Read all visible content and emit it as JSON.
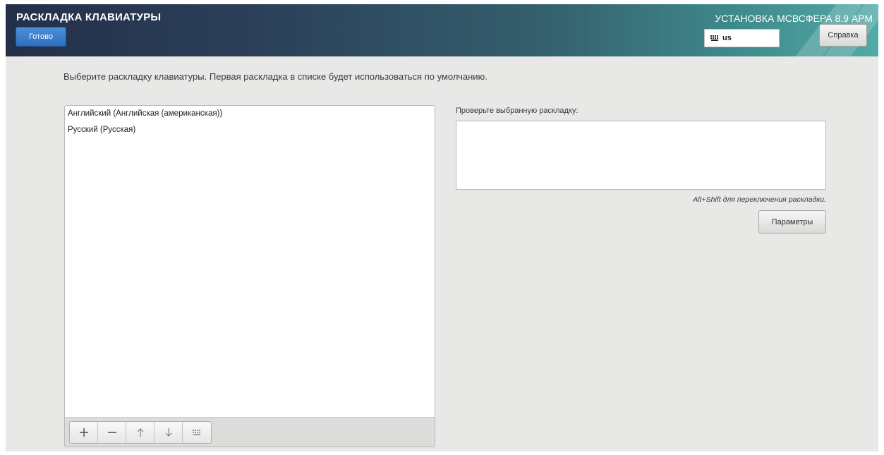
{
  "header": {
    "title": "РАСКЛАДКА КЛАВИАТУРЫ",
    "done_label": "Готово",
    "product_title": "УСТАНОВКА МСВСФЕРА 8.9 АРМ",
    "keyboard_indicator": "us",
    "help_label": "Справка"
  },
  "instruction": "Выберите раскладку клавиатуры. Первая раскладка в списке будет использоваться по умолчанию.",
  "layouts": [
    "Английский (Английская (американская))",
    "Русский (Русская)"
  ],
  "toolbar": {
    "add_icon": "plus-icon",
    "remove_icon": "minus-icon",
    "up_icon": "arrow-up-icon",
    "down_icon": "arrow-down-icon",
    "preview_icon": "keyboard-icon"
  },
  "test_panel": {
    "label": "Проверьте выбранную раскладку:",
    "value": "",
    "switch_hint": "Alt+Shift для переключения раскладки.",
    "options_label": "Параметры"
  },
  "colors": {
    "accent": "#3a7fd0",
    "header_dark": "#24304a",
    "header_light": "#52aaa6",
    "background": "#e8e8e7"
  }
}
